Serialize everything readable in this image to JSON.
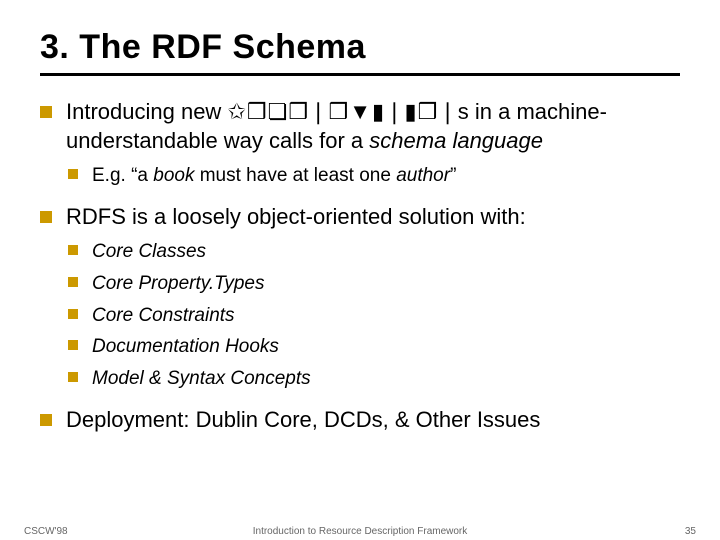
{
  "title": "3. The RDF Schema",
  "bullets": [
    {
      "pre": "Introducing new ",
      "glyphs": "✩❒❏❒❘❒▼▮❘▮❒❘",
      "post1": "s in a machine-understandable way calls for a ",
      "italic1": "schema language",
      "sub": [
        {
          "pre": "E.g. “a ",
          "it1": "book",
          "mid": " must have at least one ",
          "it2": "author",
          "post": "”"
        }
      ]
    },
    {
      "text": "RDFS is a loosely object-oriented solution with:",
      "sub": [
        {
          "italic": "Core Classes"
        },
        {
          "italic": "Core Property.Types"
        },
        {
          "italic": "Core Constraints"
        },
        {
          "italic": "Documentation Hooks"
        },
        {
          "italic": "Model & Syntax Concepts"
        }
      ]
    },
    {
      "text": "Deployment: Dublin Core, DCDs, & Other Issues"
    }
  ],
  "footer": {
    "left": "CSCW'98",
    "center": "Introduction to Resource Description Framework",
    "right": "35"
  }
}
